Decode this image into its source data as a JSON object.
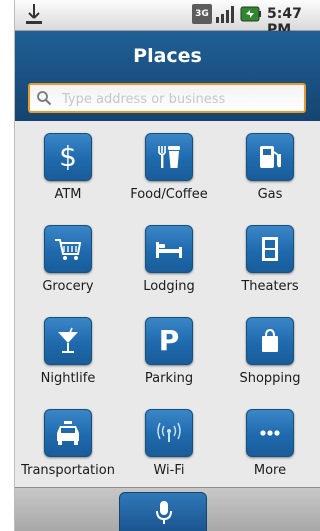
{
  "status_bar": {
    "network_label": "3G",
    "time": "5:47 PM"
  },
  "header": {
    "title": "Places"
  },
  "search": {
    "placeholder": "Type address or business"
  },
  "categories": [
    {
      "label": "ATM",
      "icon": "dollar-icon"
    },
    {
      "label": "Food/Coffee",
      "icon": "food-coffee-icon"
    },
    {
      "label": "Gas",
      "icon": "gas-pump-icon"
    },
    {
      "label": "Grocery",
      "icon": "shopping-cart-icon"
    },
    {
      "label": "Lodging",
      "icon": "bed-icon"
    },
    {
      "label": "Theaters",
      "icon": "film-icon"
    },
    {
      "label": "Nightlife",
      "icon": "cocktail-icon"
    },
    {
      "label": "Parking",
      "icon": "parking-icon"
    },
    {
      "label": "Shopping",
      "icon": "shopping-bag-icon"
    },
    {
      "label": "Transportation",
      "icon": "taxi-icon"
    },
    {
      "label": "Wi-Fi",
      "icon": "wifi-icon"
    },
    {
      "label": "More",
      "icon": "more-dots-icon"
    }
  ],
  "colors": {
    "header_blue": "#1a4f80",
    "tile_blue": "#1f6aad",
    "search_border": "#e59a2c"
  }
}
